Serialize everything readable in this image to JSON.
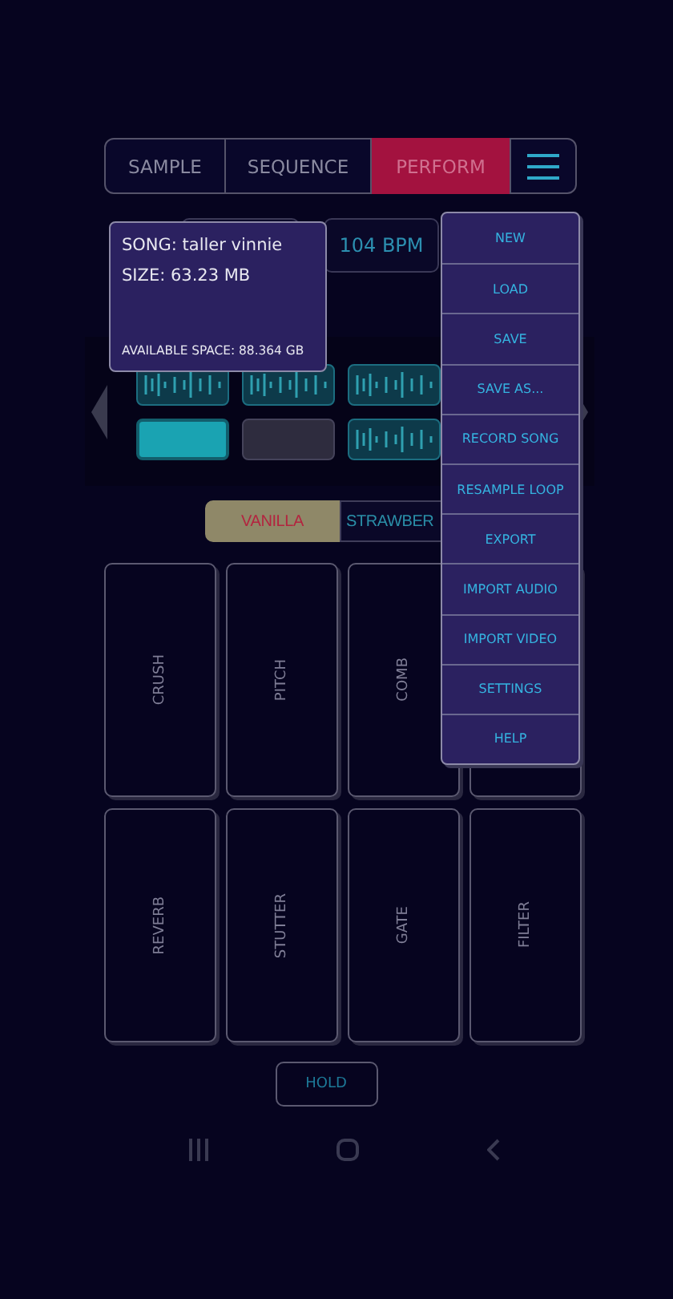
{
  "tabs": [
    {
      "label": "SAMPLE",
      "selected": false
    },
    {
      "label": "SEQUENCE",
      "selected": false
    },
    {
      "label": "PERFORM",
      "selected": true
    }
  ],
  "tempo": "104 BPM",
  "song_info": {
    "song": "SONG: taller vinnie",
    "size": "SIZE: 63.23 MB",
    "space": "AVAILABLE SPACE: 88.364 GB"
  },
  "clips": [
    {
      "kind": "pattern"
    },
    {
      "kind": "pattern"
    },
    {
      "kind": "pattern"
    },
    {
      "kind": "solid"
    },
    {
      "kind": "empty"
    },
    {
      "kind": "pattern"
    }
  ],
  "presets": [
    {
      "label": "VANILLA",
      "selected": true
    },
    {
      "label": "STRAWBER",
      "selected": false
    }
  ],
  "pads": [
    {
      "kind": "labeled",
      "label": "CRUSH"
    },
    {
      "kind": "labeled",
      "label": "PITCH"
    },
    {
      "kind": "labeled",
      "label": "COMB"
    },
    {
      "kind": "covered"
    },
    {
      "kind": "labeled",
      "label": "REVERB"
    },
    {
      "kind": "labeled",
      "label": "STUTTER"
    },
    {
      "kind": "labeled",
      "label": "GATE"
    },
    {
      "kind": "labeled",
      "label": "FILTER"
    }
  ],
  "hold": "HOLD",
  "menu": [
    "NEW",
    "LOAD",
    "SAVE",
    "SAVE AS...",
    "RECORD SONG",
    "RESAMPLE LOOP",
    "EXPORT",
    "IMPORT AUDIO",
    "IMPORT VIDEO",
    "SETTINGS",
    "HELP"
  ]
}
